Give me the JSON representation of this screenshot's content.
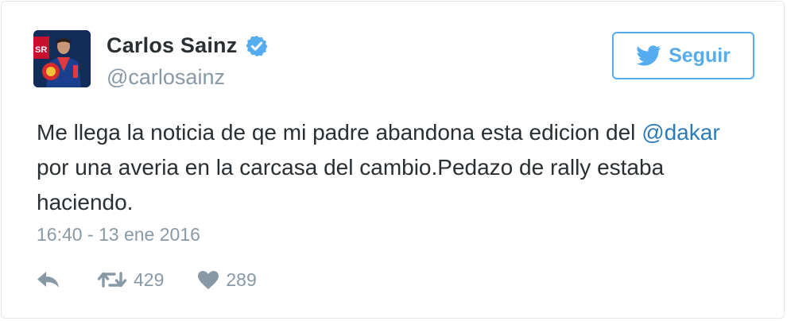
{
  "user": {
    "name": "Carlos Sainz",
    "handle": "@carlosainz",
    "avatar_icon": "profile-photo-driver-suit",
    "verified_icon": "verified-badge-icon"
  },
  "follow_button": {
    "label": "Seguir",
    "icon": "twitter-bird-icon"
  },
  "tweet": {
    "text_before": "Me llega la noticia de qe mi padre abandona esta edicion del ",
    "mention": "@dakar",
    "text_after": " por una averia en la carcasa del cambio.Pedazo de rally estaba haciendo.",
    "timestamp": "16:40 - 13 ene 2016"
  },
  "actions": {
    "reply_icon": "reply-icon",
    "retweet_icon": "retweet-icon",
    "retweet_count": "429",
    "like_icon": "heart-icon",
    "like_count": "289"
  },
  "colors": {
    "accent": "#55acee",
    "link": "#2b7bb9",
    "text": "#292f33",
    "muted": "#8899a6",
    "border": "#e1e8ed"
  }
}
